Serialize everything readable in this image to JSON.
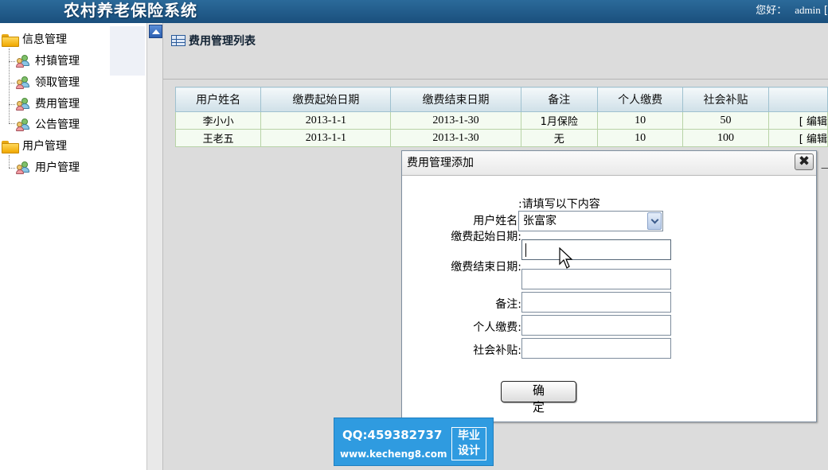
{
  "header": {
    "app_title": "农村养老保险系统",
    "greeting": "您好：",
    "username": "admin",
    "trailing": "["
  },
  "sidebar": {
    "groups": [
      {
        "label": "信息管理",
        "items": [
          "村镇管理",
          "领取管理",
          "费用管理",
          "公告管理"
        ]
      },
      {
        "label": "用户管理",
        "items": [
          "用户管理"
        ]
      }
    ]
  },
  "main": {
    "list_title": "费用管理列表",
    "table": {
      "columns": [
        "用户姓名",
        "缴费起始日期",
        "缴费结束日期",
        "备注",
        "个人缴费",
        "社会补贴",
        ""
      ],
      "rows": [
        [
          "李小小",
          "2013-1-1",
          "2013-1-30",
          "1月保险",
          "10",
          "50",
          "[ 编辑"
        ],
        [
          "王老五",
          "2013-1-1",
          "2013-1-30",
          "无",
          "10",
          "100",
          "[ 编辑"
        ]
      ]
    },
    "trailing_mark": "—"
  },
  "dialog": {
    "title": "费用管理添加",
    "close_label": "✖",
    "note": ":请填写以下内容",
    "fields": {
      "username_label": "用户姓名:",
      "username_value": "张富家",
      "start_label": "缴费起始日期:",
      "end_label": "缴费结束日期:",
      "remark_label": "备注:",
      "personal_label": "个人缴费:",
      "subsidy_label": "社会补贴:"
    },
    "submit_label": "确定"
  },
  "watermark": {
    "qq": "QQ:459382737",
    "site": "www.kecheng8.com",
    "badge_line1": "毕业",
    "badge_line2": "设计"
  }
}
